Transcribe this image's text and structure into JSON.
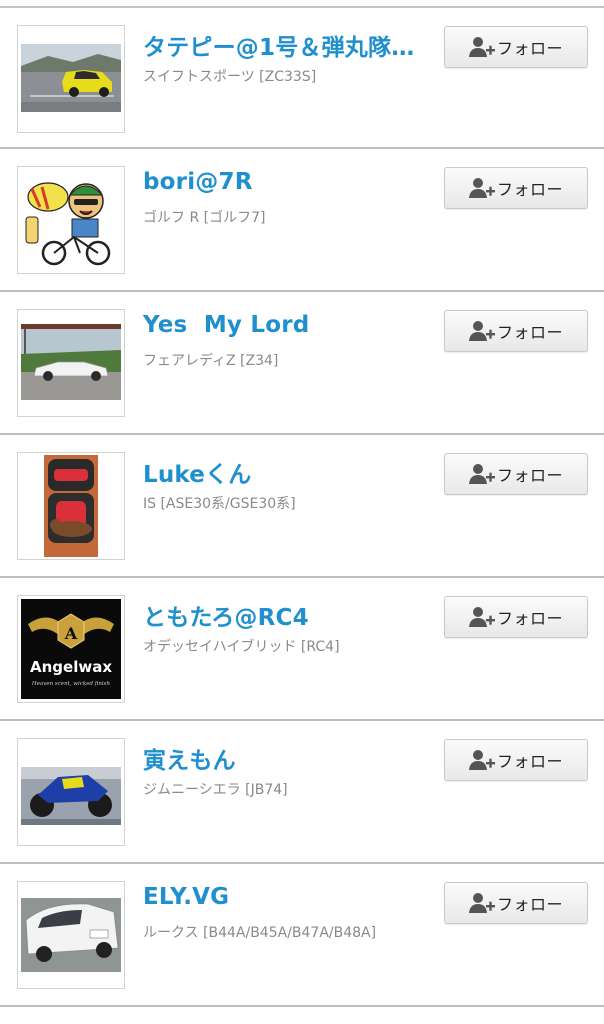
{
  "users": [
    {
      "name": "タテピー@1号＆弾丸隊…",
      "car": "スイフトスポーツ [ZC33S]",
      "follow_label": "フォロー",
      "avatar": "yellow-hatchback-photo"
    },
    {
      "name": "bori@7R",
      "car": "ゴルフ R [ゴルフ7]",
      "follow_label": "フォロー",
      "avatar": "cartoon-cyclist-illustration"
    },
    {
      "name": "Yes  My Lord",
      "car": "フェアレディZ [Z34]",
      "follow_label": "フォロー",
      "avatar": "white-convertible-photo"
    },
    {
      "name": "Lukeくん",
      "car": "IS [ASE30系/GSE30系]",
      "follow_label": "フォロー",
      "avatar": "dog-in-car-seat-photo"
    },
    {
      "name": "ともたろ@RC4",
      "car": "オデッセイハイブリッド [RC4]",
      "follow_label": "フォロー",
      "avatar": "angelwax-logo",
      "avatar_text": "Angelwax",
      "avatar_tagline": "Heaven scent, wicked finish",
      "avatar_letter": "A"
    },
    {
      "name": "寅えもん",
      "car": "ジムニーシエラ [JB74]",
      "follow_label": "フォロー",
      "avatar": "blue-motorcycle-photo"
    },
    {
      "name": "ELY.VG",
      "car": "ルークス [B44A/B45A/B47A/B48A]",
      "follow_label": "フォロー",
      "avatar": "white-minivan-photo"
    }
  ],
  "icons": {
    "follow": "add-user-icon"
  },
  "colors": {
    "name_link": "#1f8fce",
    "car_text": "#8a8a8a",
    "divider": "#bdbdbd"
  }
}
